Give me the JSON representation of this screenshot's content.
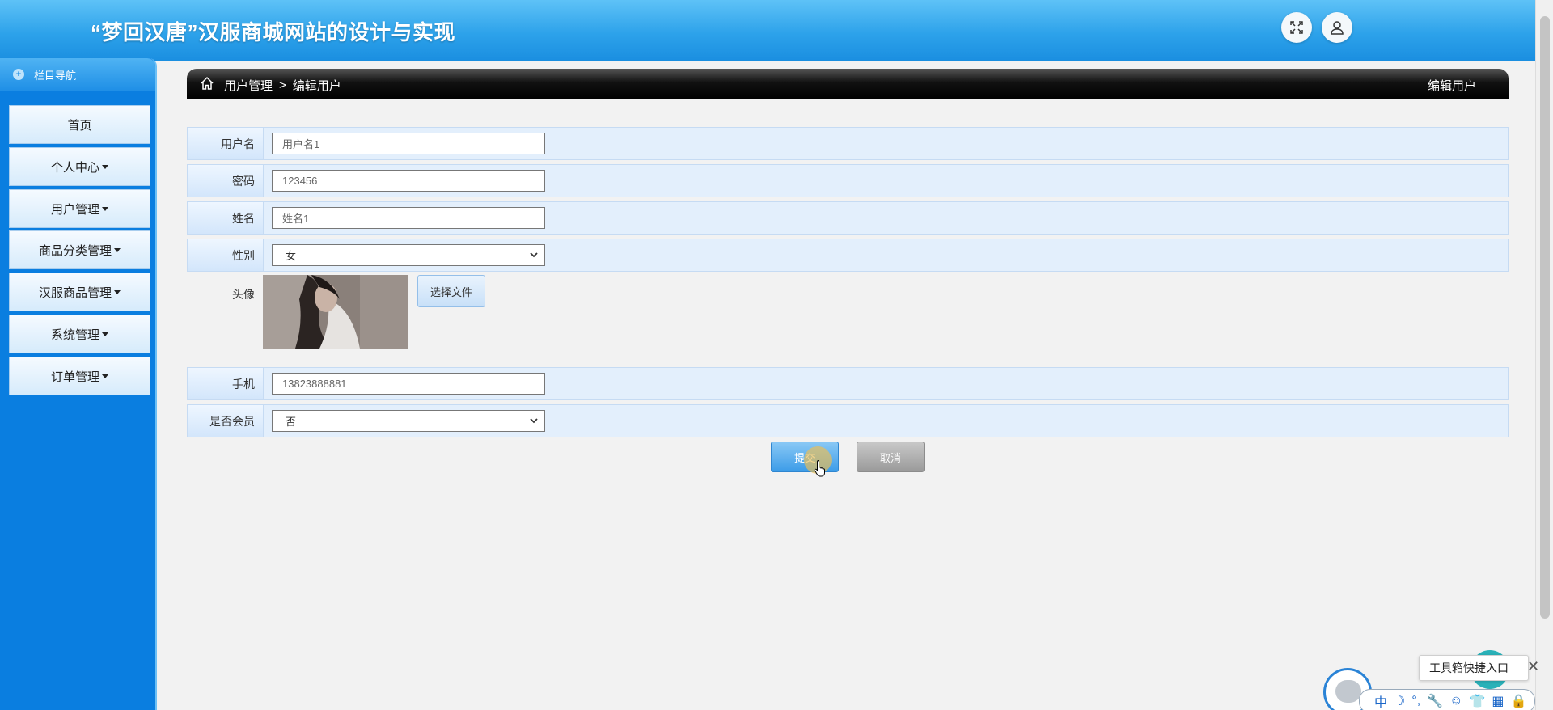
{
  "header": {
    "title": "“梦回汉唐”汉服商城网站的设计与实现"
  },
  "sidebar": {
    "nav_title": "栏目导航",
    "items": [
      {
        "label": "首页",
        "has_caret": false
      },
      {
        "label": "个人中心",
        "has_caret": true
      },
      {
        "label": "用户管理",
        "has_caret": true
      },
      {
        "label": "商品分类管理",
        "has_caret": true
      },
      {
        "label": "汉服商品管理",
        "has_caret": true
      },
      {
        "label": "系统管理",
        "has_caret": true
      },
      {
        "label": "订单管理",
        "has_caret": true
      }
    ]
  },
  "breadcrumb": {
    "section": "用户管理",
    "separator": ">",
    "current": "编辑用户",
    "page_title": "编辑用户"
  },
  "form": {
    "username": {
      "label": "用户名",
      "value": "用户名1"
    },
    "password": {
      "label": "密码",
      "value": "123456"
    },
    "name": {
      "label": "姓名",
      "value": "姓名1"
    },
    "gender": {
      "label": "性别",
      "value": "女"
    },
    "avatar": {
      "label": "头像",
      "choose_label": "选择文件"
    },
    "phone": {
      "label": "手机",
      "value": "13823888881"
    },
    "member": {
      "label": "是否会员",
      "value": "否"
    }
  },
  "actions": {
    "submit_label": "提交",
    "cancel_label": "取消"
  },
  "toolbox": {
    "tooltip": "工具箱快捷入口",
    "close": "✕",
    "ime_chars": [
      "中",
      "☽",
      "°,",
      "🔧",
      "☺",
      "👕",
      "▦",
      "🔒"
    ]
  }
}
